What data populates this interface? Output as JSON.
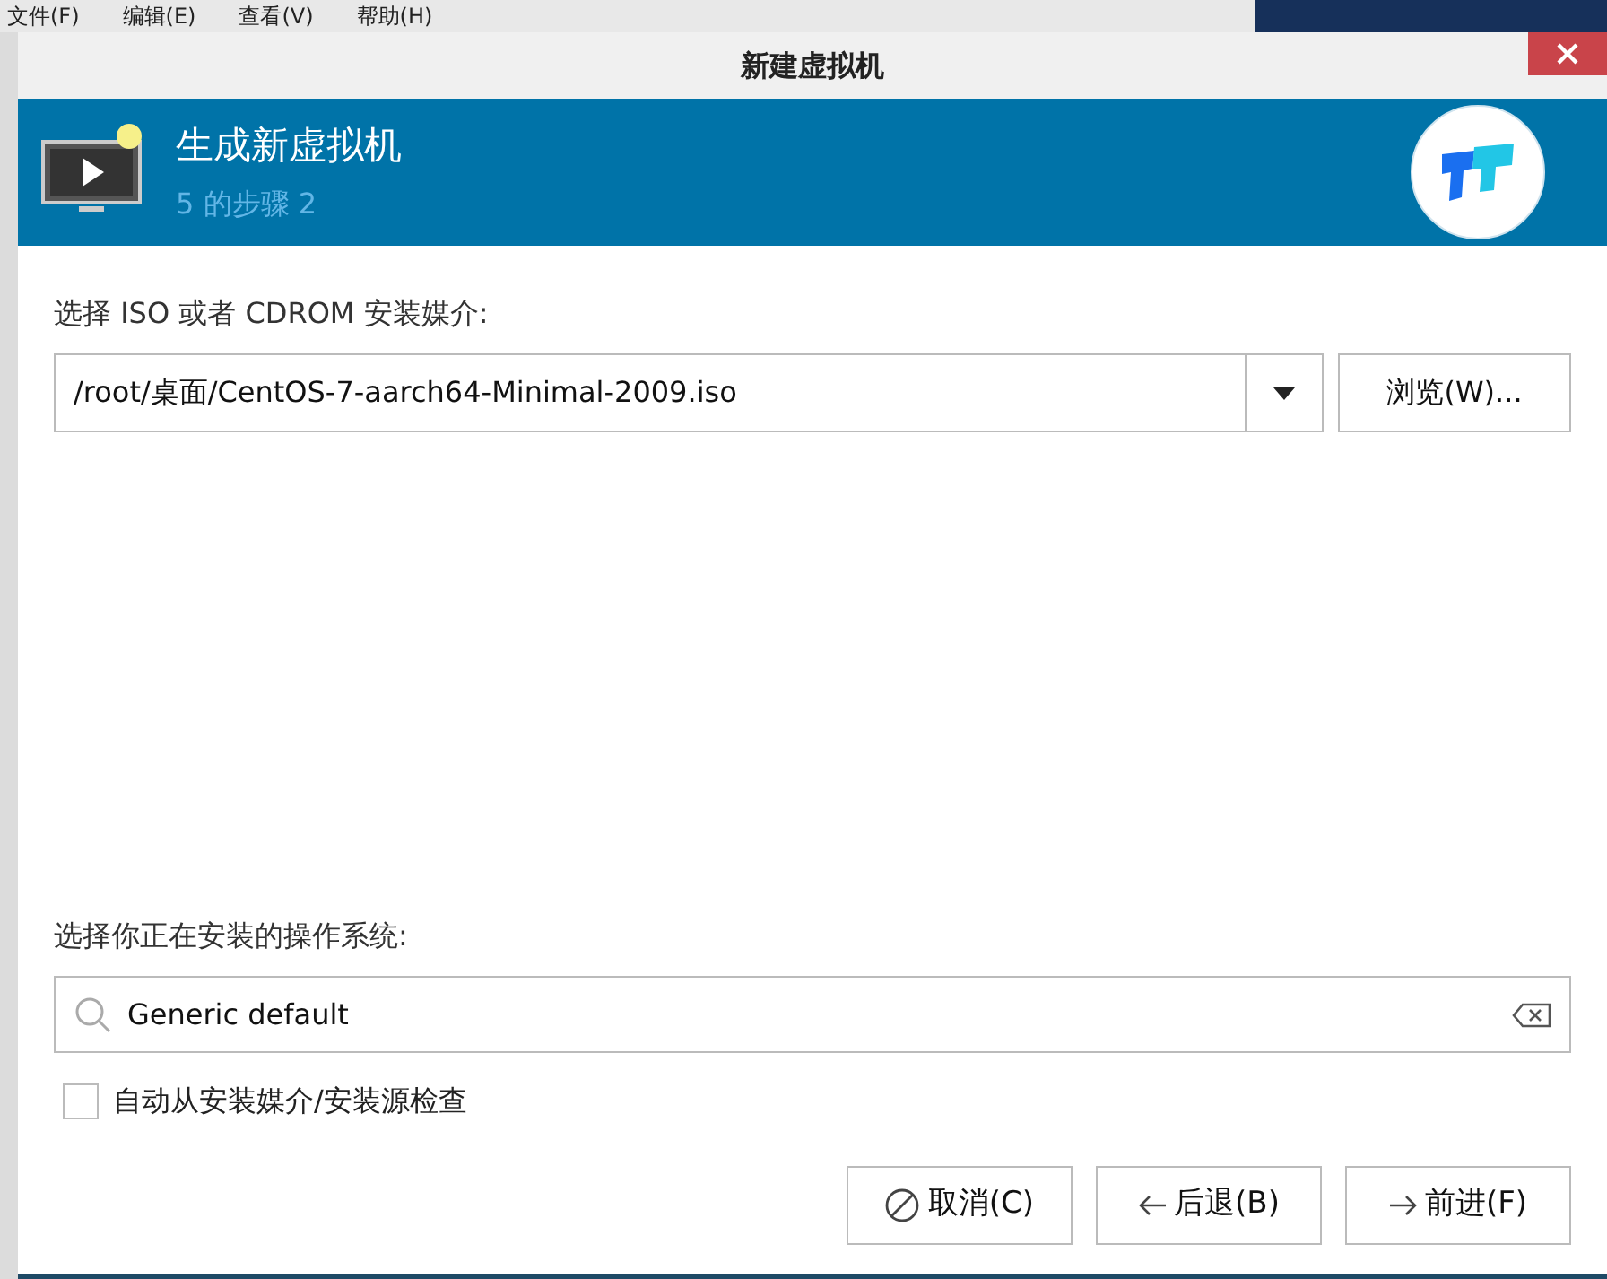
{
  "background_menu": [
    "文件(F)",
    "编辑(E)",
    "查看(V)",
    "帮助(H)"
  ],
  "window": {
    "title": "新建虚拟机"
  },
  "header": {
    "title": "生成新虚拟机",
    "subtitle": "5 的步骤 2"
  },
  "install_media": {
    "label": "选择 ISO 或者 CDROM 安装媒介:",
    "value": "/root/桌面/CentOS-7-aarch64-Minimal-2009.iso",
    "browse_button": "浏览(W)..."
  },
  "os": {
    "label": "选择你正在安装的操作系统:",
    "value": "Generic default"
  },
  "auto_detect": {
    "label": "自动从安装媒介/安装源检查",
    "checked": false
  },
  "buttons": [
    {
      "label": "取消(C)",
      "kind": "cancel"
    },
    {
      "label": "后退(B)",
      "kind": "back"
    },
    {
      "label": "前进(F)",
      "kind": "forward"
    }
  ]
}
